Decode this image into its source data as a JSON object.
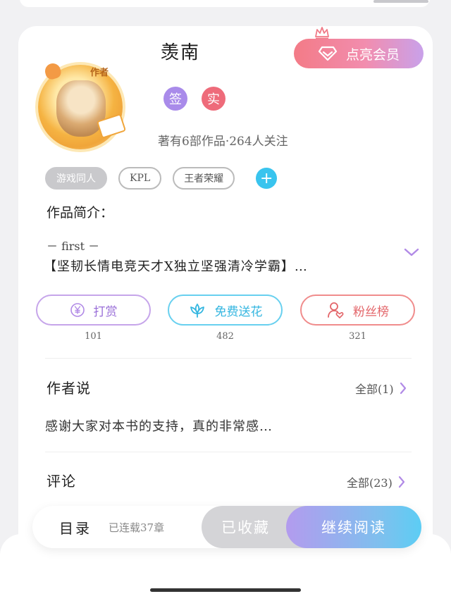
{
  "author": {
    "name": "羡南",
    "badges": [
      "签",
      "实"
    ],
    "stats": "著有6部作品·264人关注",
    "avatar_badge": "作者"
  },
  "vip": {
    "label": "点亮会员"
  },
  "tags": [
    "游戏同人",
    "KPL",
    "王者荣耀"
  ],
  "intro": {
    "title": "作品简介：",
    "first_line": "－ first －",
    "text": "【坚韧长情电竞天才X独立坚强清冷学霸】…"
  },
  "actions": [
    {
      "label": "打赏",
      "count": "101",
      "icon": "yen-icon"
    },
    {
      "label": "免费送花",
      "count": "482",
      "icon": "flower-icon"
    },
    {
      "label": "粉丝榜",
      "count": "321",
      "icon": "fans-icon"
    }
  ],
  "author_note": {
    "title": "作者说",
    "more": "全部(1)",
    "text": "感谢大家对本书的支持，真的非常感…"
  },
  "comments": {
    "title": "评论",
    "more": "全部(23)"
  },
  "bottom_bar": {
    "toc": "目录",
    "chapters": "已连载37章",
    "collected": "已收藏",
    "continue": "继续阅读"
  },
  "colors": {
    "accent_purple": "#a98bea",
    "accent_blue": "#39c4ee",
    "accent_red": "#ee6b7a"
  }
}
